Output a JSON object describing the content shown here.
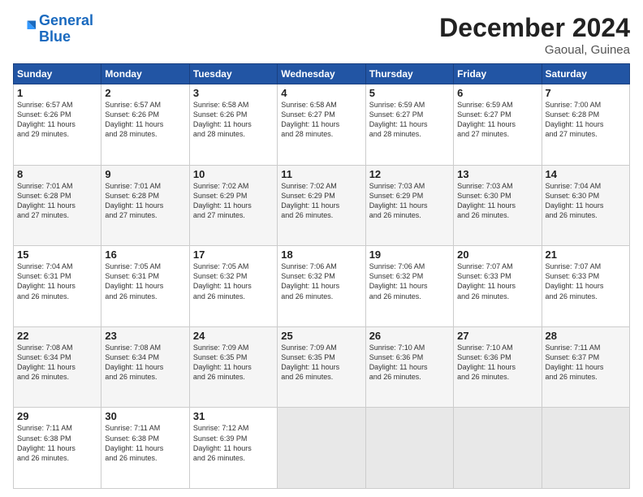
{
  "logo": {
    "line1": "General",
    "line2": "Blue"
  },
  "title": "December 2024",
  "subtitle": "Gaoual, Guinea",
  "days_header": [
    "Sunday",
    "Monday",
    "Tuesday",
    "Wednesday",
    "Thursday",
    "Friday",
    "Saturday"
  ],
  "weeks": [
    [
      {
        "day": "1",
        "info": "Sunrise: 6:57 AM\nSunset: 6:26 PM\nDaylight: 11 hours\nand 29 minutes."
      },
      {
        "day": "2",
        "info": "Sunrise: 6:57 AM\nSunset: 6:26 PM\nDaylight: 11 hours\nand 28 minutes."
      },
      {
        "day": "3",
        "info": "Sunrise: 6:58 AM\nSunset: 6:26 PM\nDaylight: 11 hours\nand 28 minutes."
      },
      {
        "day": "4",
        "info": "Sunrise: 6:58 AM\nSunset: 6:27 PM\nDaylight: 11 hours\nand 28 minutes."
      },
      {
        "day": "5",
        "info": "Sunrise: 6:59 AM\nSunset: 6:27 PM\nDaylight: 11 hours\nand 28 minutes."
      },
      {
        "day": "6",
        "info": "Sunrise: 6:59 AM\nSunset: 6:27 PM\nDaylight: 11 hours\nand 27 minutes."
      },
      {
        "day": "7",
        "info": "Sunrise: 7:00 AM\nSunset: 6:28 PM\nDaylight: 11 hours\nand 27 minutes."
      }
    ],
    [
      {
        "day": "8",
        "info": "Sunrise: 7:01 AM\nSunset: 6:28 PM\nDaylight: 11 hours\nand 27 minutes."
      },
      {
        "day": "9",
        "info": "Sunrise: 7:01 AM\nSunset: 6:28 PM\nDaylight: 11 hours\nand 27 minutes."
      },
      {
        "day": "10",
        "info": "Sunrise: 7:02 AM\nSunset: 6:29 PM\nDaylight: 11 hours\nand 27 minutes."
      },
      {
        "day": "11",
        "info": "Sunrise: 7:02 AM\nSunset: 6:29 PM\nDaylight: 11 hours\nand 26 minutes."
      },
      {
        "day": "12",
        "info": "Sunrise: 7:03 AM\nSunset: 6:29 PM\nDaylight: 11 hours\nand 26 minutes."
      },
      {
        "day": "13",
        "info": "Sunrise: 7:03 AM\nSunset: 6:30 PM\nDaylight: 11 hours\nand 26 minutes."
      },
      {
        "day": "14",
        "info": "Sunrise: 7:04 AM\nSunset: 6:30 PM\nDaylight: 11 hours\nand 26 minutes."
      }
    ],
    [
      {
        "day": "15",
        "info": "Sunrise: 7:04 AM\nSunset: 6:31 PM\nDaylight: 11 hours\nand 26 minutes."
      },
      {
        "day": "16",
        "info": "Sunrise: 7:05 AM\nSunset: 6:31 PM\nDaylight: 11 hours\nand 26 minutes."
      },
      {
        "day": "17",
        "info": "Sunrise: 7:05 AM\nSunset: 6:32 PM\nDaylight: 11 hours\nand 26 minutes."
      },
      {
        "day": "18",
        "info": "Sunrise: 7:06 AM\nSunset: 6:32 PM\nDaylight: 11 hours\nand 26 minutes."
      },
      {
        "day": "19",
        "info": "Sunrise: 7:06 AM\nSunset: 6:32 PM\nDaylight: 11 hours\nand 26 minutes."
      },
      {
        "day": "20",
        "info": "Sunrise: 7:07 AM\nSunset: 6:33 PM\nDaylight: 11 hours\nand 26 minutes."
      },
      {
        "day": "21",
        "info": "Sunrise: 7:07 AM\nSunset: 6:33 PM\nDaylight: 11 hours\nand 26 minutes."
      }
    ],
    [
      {
        "day": "22",
        "info": "Sunrise: 7:08 AM\nSunset: 6:34 PM\nDaylight: 11 hours\nand 26 minutes."
      },
      {
        "day": "23",
        "info": "Sunrise: 7:08 AM\nSunset: 6:34 PM\nDaylight: 11 hours\nand 26 minutes."
      },
      {
        "day": "24",
        "info": "Sunrise: 7:09 AM\nSunset: 6:35 PM\nDaylight: 11 hours\nand 26 minutes."
      },
      {
        "day": "25",
        "info": "Sunrise: 7:09 AM\nSunset: 6:35 PM\nDaylight: 11 hours\nand 26 minutes."
      },
      {
        "day": "26",
        "info": "Sunrise: 7:10 AM\nSunset: 6:36 PM\nDaylight: 11 hours\nand 26 minutes."
      },
      {
        "day": "27",
        "info": "Sunrise: 7:10 AM\nSunset: 6:36 PM\nDaylight: 11 hours\nand 26 minutes."
      },
      {
        "day": "28",
        "info": "Sunrise: 7:11 AM\nSunset: 6:37 PM\nDaylight: 11 hours\nand 26 minutes."
      }
    ],
    [
      {
        "day": "29",
        "info": "Sunrise: 7:11 AM\nSunset: 6:38 PM\nDaylight: 11 hours\nand 26 minutes."
      },
      {
        "day": "30",
        "info": "Sunrise: 7:11 AM\nSunset: 6:38 PM\nDaylight: 11 hours\nand 26 minutes."
      },
      {
        "day": "31",
        "info": "Sunrise: 7:12 AM\nSunset: 6:39 PM\nDaylight: 11 hours\nand 26 minutes."
      },
      {
        "day": "",
        "info": ""
      },
      {
        "day": "",
        "info": ""
      },
      {
        "day": "",
        "info": ""
      },
      {
        "day": "",
        "info": ""
      }
    ]
  ]
}
